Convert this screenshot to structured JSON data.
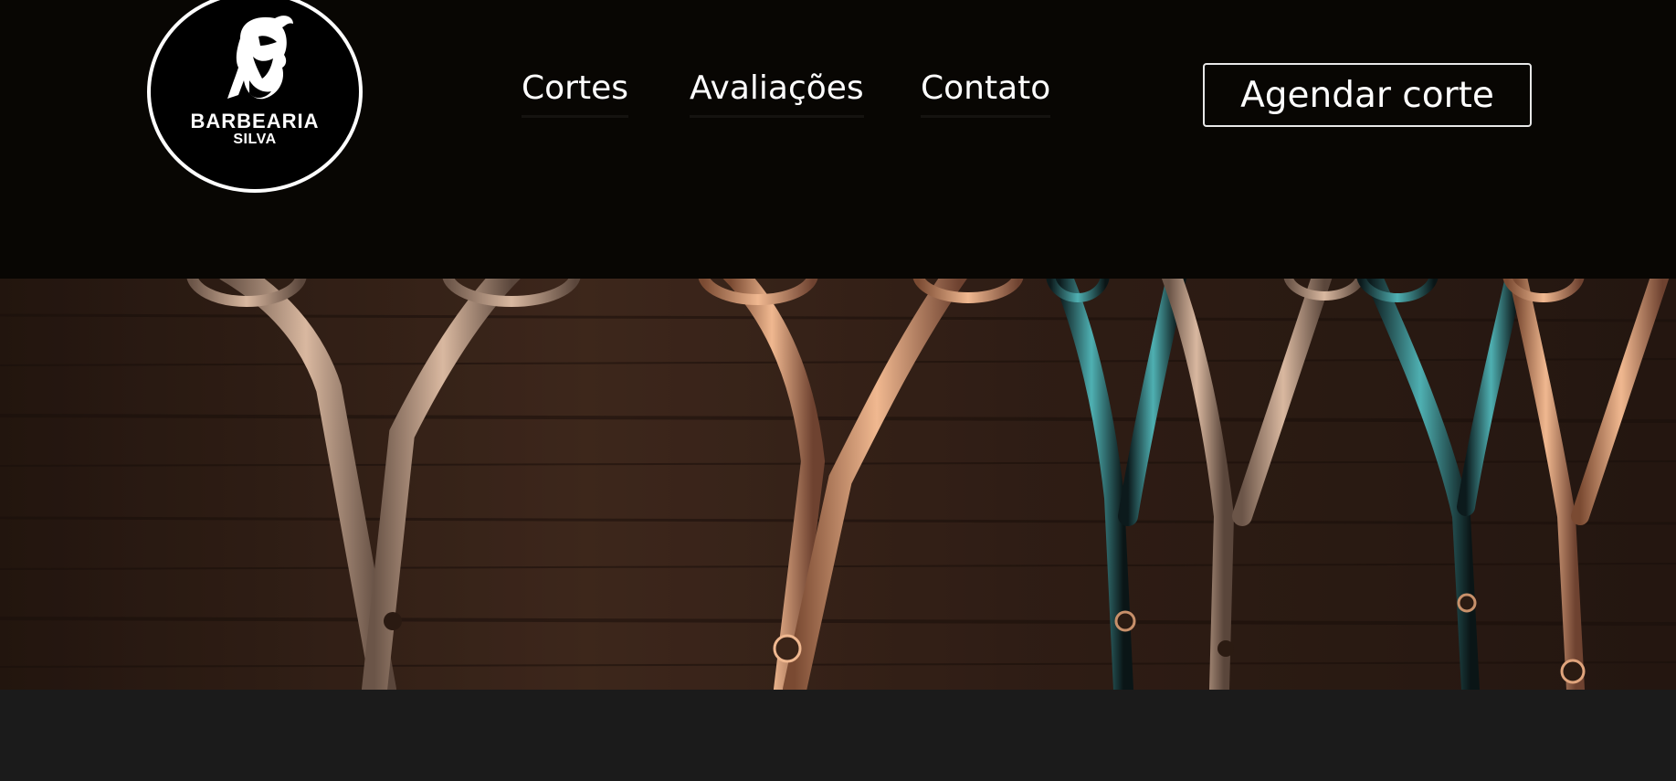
{
  "brand": {
    "name": "BARBEARIA",
    "subname": "SILVA",
    "logo_icon": "bearded-man-icon"
  },
  "nav": {
    "items": [
      {
        "label": "Cortes"
      },
      {
        "label": "Avaliações"
      },
      {
        "label": "Contato"
      }
    ]
  },
  "cta": {
    "label": "Agendar corte"
  },
  "hero": {
    "image": "barber-scissors-on-wood-photo"
  },
  "colors": {
    "header_bg": "#080603",
    "page_bg": "#1b1b1b",
    "text": "#ffffff",
    "wood": "#4a2e1f"
  }
}
